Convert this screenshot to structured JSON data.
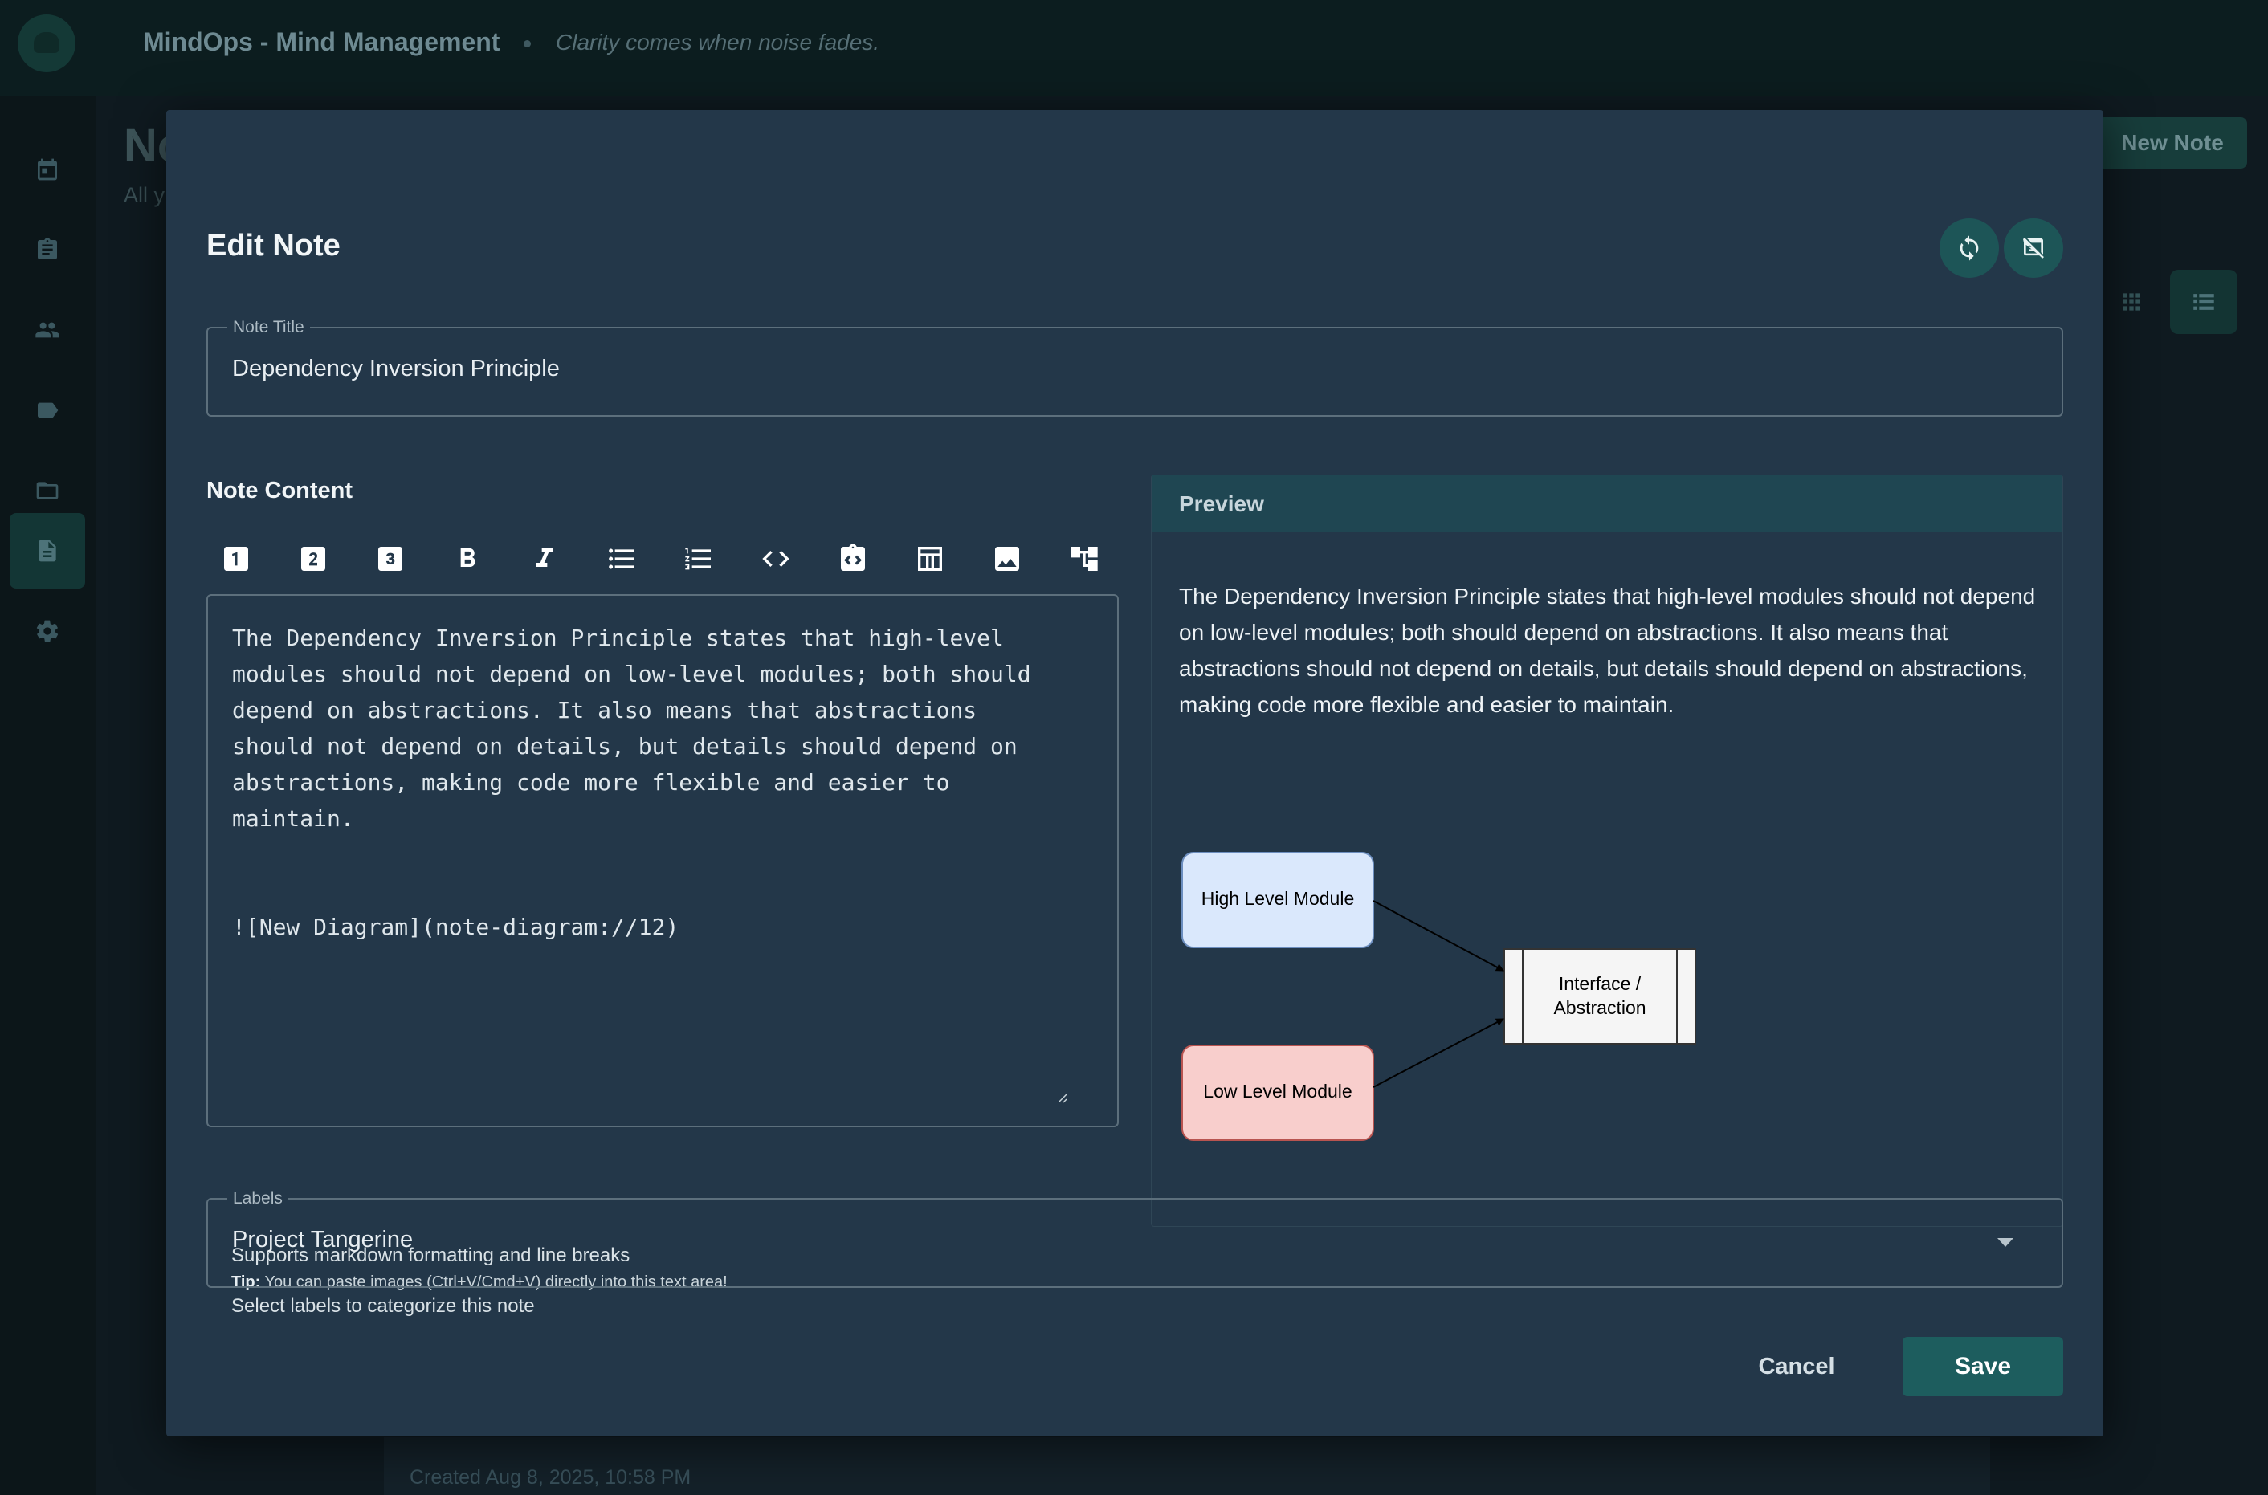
{
  "app": {
    "title": "MindOps - Mind Management",
    "tagline": "Clarity comes when noise fades."
  },
  "sidebar": {
    "items": [
      {
        "icon": "calendar-icon",
        "active": false
      },
      {
        "icon": "clipboard-icon",
        "active": false
      },
      {
        "icon": "people-icon",
        "active": false
      },
      {
        "icon": "label-icon",
        "active": false
      },
      {
        "icon": "folder-icon",
        "active": false
      },
      {
        "icon": "note-icon",
        "active": true
      },
      {
        "icon": "gear-icon",
        "active": false
      }
    ]
  },
  "page": {
    "heading": "No",
    "subtitle": "All y",
    "new_note_label": "New Note",
    "created": "Created Aug 8, 2025, 10:58 PM"
  },
  "modal": {
    "title": "Edit Note",
    "note_title_label": "Note Title",
    "note_title_value": "Dependency Inversion Principle",
    "content_label": "Note Content",
    "toolbar": [
      {
        "name": "heading-1-icon",
        "glyph": "1"
      },
      {
        "name": "heading-2-icon",
        "glyph": "2"
      },
      {
        "name": "heading-3-icon",
        "glyph": "3"
      },
      {
        "name": "bold-icon",
        "glyph": "B"
      },
      {
        "name": "italic-icon",
        "glyph": "I"
      },
      {
        "name": "bulleted-list-icon"
      },
      {
        "name": "numbered-list-icon"
      },
      {
        "name": "code-icon"
      },
      {
        "name": "code-block-icon"
      },
      {
        "name": "table-icon"
      },
      {
        "name": "image-icon"
      },
      {
        "name": "diagram-icon"
      }
    ],
    "content_value": "The Dependency Inversion Principle states that high-level\nmodules should not depend on low-level modules; both should\ndepend on abstractions. It also means that abstractions\nshould not depend on details, but details should depend on\nabstractions, making code more flexible and easier to\nmaintain.\n\n\n![New Diagram](note-diagram://12)",
    "help_text": "Supports markdown formatting and line breaks",
    "tip_label": "Tip:",
    "tip_text": " You can paste images (Ctrl+V/Cmd+V) directly into this text area!",
    "preview": {
      "label": "Preview",
      "text": "The Dependency Inversion Principle states that high-level modules should not depend on low-level modules; both should depend on abstractions. It also means that abstractions should not depend on details, but details should depend on abstractions, making code more flexible and easier to maintain.",
      "diagram": {
        "high_level": "High Level Module",
        "low_level": "Low Level Module",
        "interface_line1": "Interface /",
        "interface_line2": "Abstraction",
        "colors": {
          "high_fill": "#dae8fc",
          "high_stroke": "#6c8ebf",
          "low_fill": "#f8cecc",
          "low_stroke": "#b85450",
          "box_fill": "#f5f5f5",
          "box_stroke": "#333333"
        }
      }
    },
    "labels_label": "Labels",
    "labels_value": "Project Tangerine",
    "labels_help": "Select labels to categorize this note",
    "cancel_label": "Cancel",
    "save_label": "Save"
  },
  "colors": {
    "modal_bg": "#233749",
    "accent": "#1d5d5e",
    "preview_header": "#1f4652"
  }
}
